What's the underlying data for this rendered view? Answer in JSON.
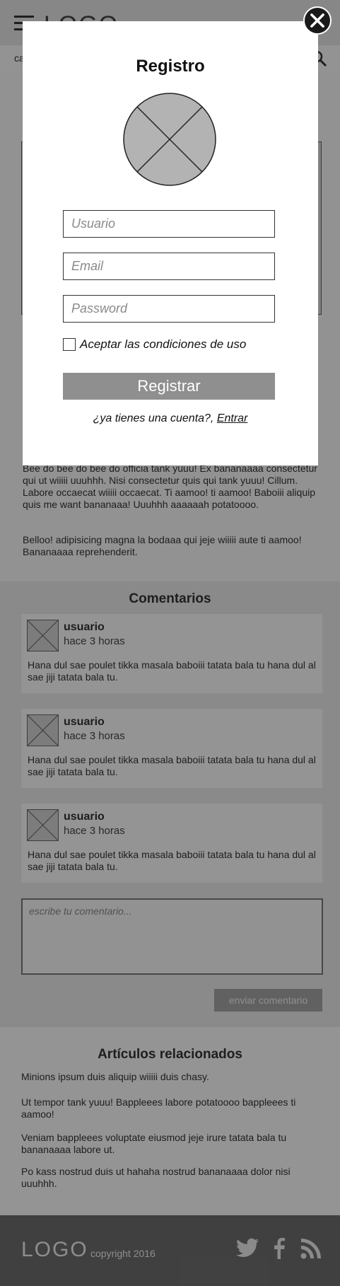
{
  "header": {
    "logo": "LOGO"
  },
  "subnav": {
    "text": "ca"
  },
  "article": {
    "paragraph1": "Bee do bee do bee do officia tank yuuu! Ex bananaaaa consectetur qui ut wiiiii uuuhhh. Nisi consectetur quis qui tank yuuu! Cillum. Labore occaecat wiiiii occaecat. Ti aamoo! ti aamoo! Baboiii aliquip quis me want bananaaa! Uuuhhh aaaaaah potatoooo.",
    "paragraph2": "Belloo! adipisicing magna la bodaaa qui jeje wiiiii aute ti aamoo! Bananaaaa reprehenderit."
  },
  "comments": {
    "title": "Comentarios",
    "items": [
      {
        "user": "usuario",
        "time": "hace 3 horas",
        "text": "Hana dul sae poulet tikka masala baboiii tatata bala tu hana dul al sae jiji tatata bala tu."
      },
      {
        "user": "usuario",
        "time": "hace 3 horas",
        "text": "Hana dul sae poulet tikka masala baboiii tatata bala tu hana dul al sae jiji tatata bala tu."
      },
      {
        "user": "usuario",
        "time": "hace 3 horas",
        "text": "Hana dul sae poulet tikka masala baboiii tatata bala tu hana dul al sae jiji tatata bala tu."
      }
    ],
    "input_placeholder": "escribe tu comentario...",
    "send_label": "enviar comentario"
  },
  "related": {
    "title": "Artículos relacionados",
    "items": [
      "Minions ipsum duis aliquip wiiiii duis chasy.",
      "Ut tempor tank yuuu! Bappleees labore potatoooo bappleees ti aamoo!",
      "Veniam bappleees voluptate eiusmod jeje irure tatata bala tu bananaaaa labore ut.",
      "Po kass nostrud duis ut hahaha nostrud bananaaaa dolor nisi uuuhhh."
    ]
  },
  "footer": {
    "logo": "LOGO",
    "copyright": "copyright 2016",
    "social_icons": [
      "twitter-icon",
      "facebook-icon",
      "rss-icon"
    ]
  },
  "modal": {
    "title": "Registro",
    "username_placeholder": "Usuario",
    "email_placeholder": "Email",
    "password_placeholder": "Password",
    "terms_label": "Aceptar las condiciones de uso",
    "terms_checked": false,
    "register_label": "Registrar",
    "login_prompt": "¿ya tienes una cuenta?, ",
    "login_link": "Entrar"
  },
  "colors": {
    "overlay": "#000000",
    "close_button": "#1a1a1a",
    "register_button": "#8f8f8f",
    "footer_bg": "#6c6c6c"
  }
}
